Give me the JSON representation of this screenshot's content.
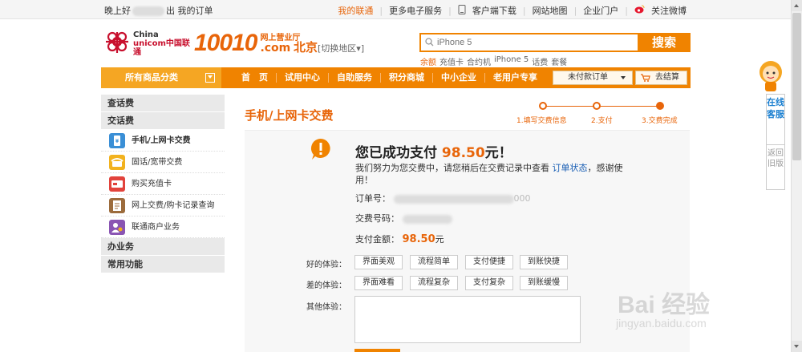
{
  "topbar": {
    "greeting": "晚上好",
    "logout_my_orders": "出 我的订单",
    "links": [
      "我的联通",
      "更多电子服务",
      "客户端下载",
      "网站地图",
      "企业门户",
      "关注微博"
    ]
  },
  "header": {
    "logo_line1": "China",
    "logo_line2": "unicom中国联通",
    "logo_number": "10010",
    "logo_sub1": "网上营业厅",
    "logo_sub2": ".com",
    "city": "北京",
    "city_switch": "[切换地区▾]",
    "search_placeholder": "iPhone 5",
    "search_button": "搜索",
    "hotwords": [
      "余额",
      "充值卡",
      "合约机",
      "iPhone 5",
      "话费",
      "套餐"
    ]
  },
  "nav": {
    "category_label": "所有商品分类",
    "items": [
      "首　页",
      "试用中心",
      "自助服务",
      "积分商城",
      "中小企业",
      "老用户专享"
    ],
    "unpaid_orders": "未付款订单",
    "cart": "去结算"
  },
  "sidebar": {
    "section1": "查话费",
    "section2": "交话费",
    "items": [
      {
        "label": "手机/上网卡交费",
        "color": "#3a8fd6"
      },
      {
        "label": "固话/宽带交费",
        "color": "#f2b21e"
      },
      {
        "label": "购买充值卡",
        "color": "#e2433c"
      },
      {
        "label": "网上交费/购卡记录查询",
        "color": "#9c6b3c"
      },
      {
        "label": "联通商户业务",
        "color": "#8a55b3"
      }
    ],
    "section3": "办业务",
    "section4": "常用功能"
  },
  "main": {
    "title": "手机/上网卡交费",
    "steps": [
      "1.填写交费信息",
      "2.支付",
      "3.交费完成"
    ],
    "success_prefix": "您已成功支付 ",
    "success_amount": "98.50",
    "success_suffix": "元！",
    "desc_text": "我们努力为您交费中，请您稍后在交费记录中查看 ",
    "desc_link": "订单状态",
    "desc_end": "，感谢使用！",
    "order_label": "订单号：",
    "order_value_tail": "000",
    "pay_no_label": "交费号码：",
    "amount_label": "支付金额：",
    "amount_value": "98.50",
    "amount_unit": "元"
  },
  "feedback": {
    "good_label": "好的体验：",
    "good": [
      "界面美观",
      "流程简单",
      "支付便捷",
      "到账快捷"
    ],
    "bad_label": "差的体验：",
    "bad": [
      "界面难看",
      "流程复杂",
      "支付复杂",
      "到账缓慢"
    ],
    "other_label": "其他体验："
  },
  "float": {
    "online": "在线客服",
    "back": "返回旧版"
  },
  "watermark": {
    "line1": "Bai 经验",
    "line2": "jingyan.baidu.com"
  },
  "colors": {
    "accent": "#f08300",
    "accent_text": "#e8650a",
    "link": "#1a5fb4"
  }
}
